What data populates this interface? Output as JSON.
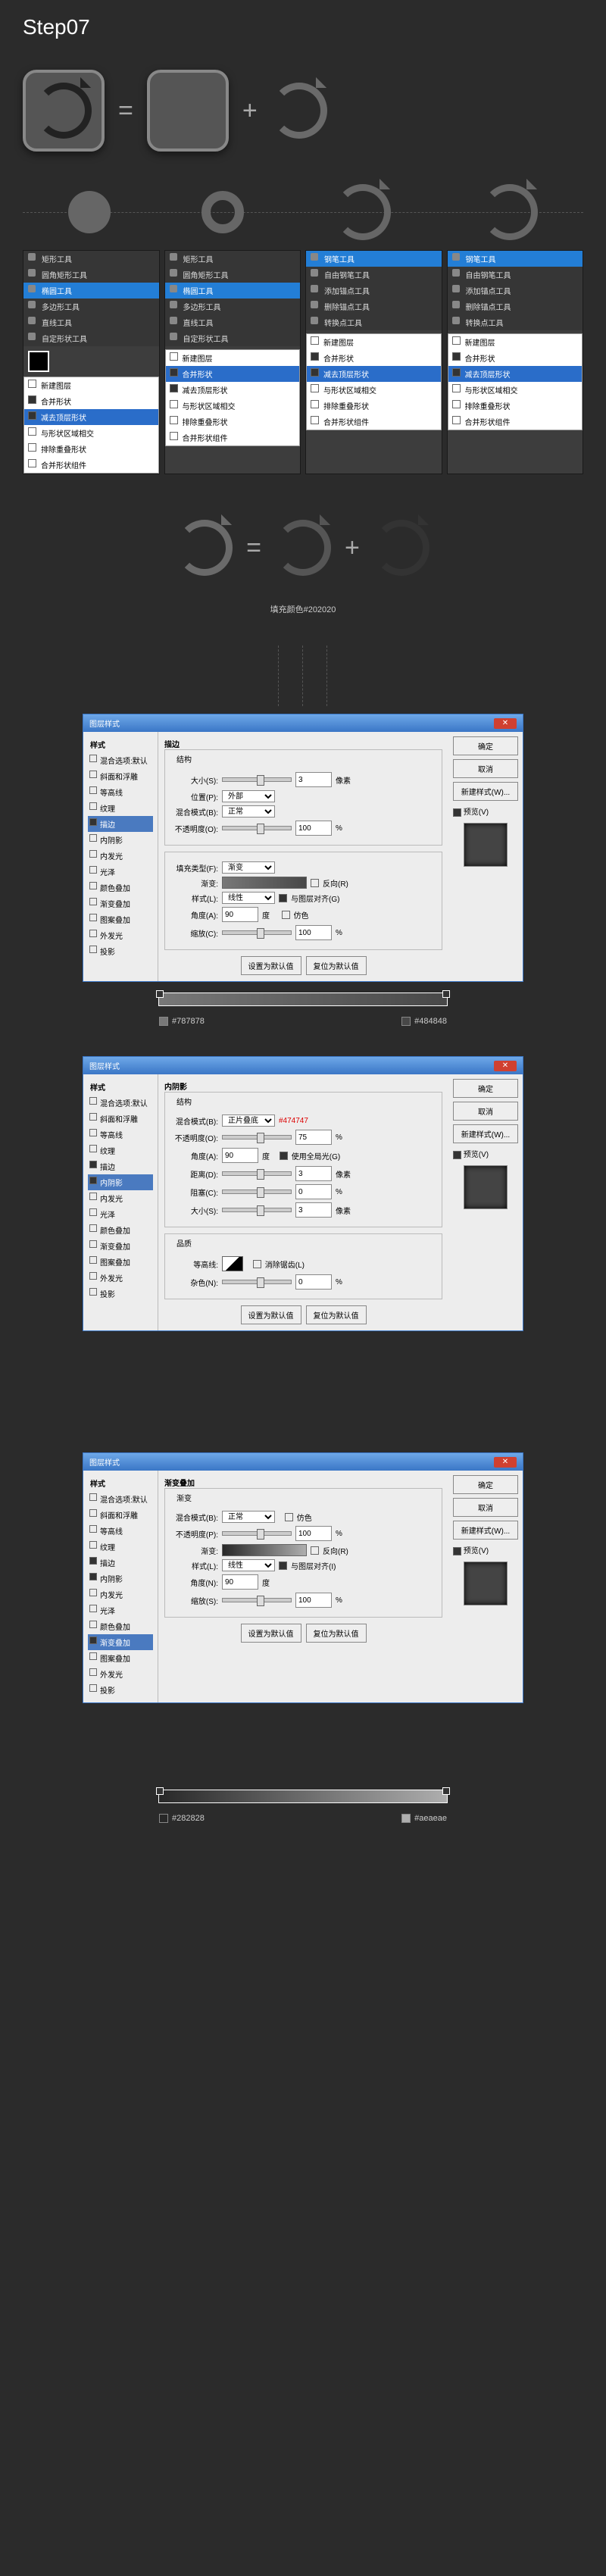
{
  "title": "Step07",
  "ops": {
    "eq": "=",
    "plus": "+"
  },
  "fill_label": "填充颜色#202020",
  "tool_groups": [
    {
      "items": [
        "矩形工具",
        "圆角矩形工具",
        "椭圆工具",
        "多边形工具",
        "直线工具",
        "自定形状工具"
      ],
      "sel": 2,
      "sub": {
        "items": [
          "新建图层",
          "合并形状",
          "减去顶层形状",
          "与形状区域相交",
          "排除重叠形状",
          "合并形状组件"
        ],
        "sel": 3
      }
    },
    {
      "items": [
        "矩形工具",
        "圆角矩形工具",
        "椭圆工具",
        "多边形工具",
        "直线工具",
        "自定形状工具"
      ],
      "sel": 2,
      "sub": {
        "items": [
          "新建图层",
          "合并形状",
          "减去顶层形状",
          "与形状区域相交",
          "排除重叠形状",
          "合并形状组件"
        ],
        "sel": 2
      }
    },
    {
      "items": [
        "钢笔工具",
        "自由钢笔工具",
        "添加锚点工具",
        "删除锚点工具",
        "转换点工具"
      ],
      "sel": 0,
      "sub": {
        "items": [
          "新建图层",
          "合并形状",
          "减去顶层形状",
          "与形状区域相交",
          "排除重叠形状",
          "合并形状组件"
        ],
        "sel": 2
      }
    },
    {
      "items": [
        "钢笔工具",
        "自由钢笔工具",
        "添加锚点工具",
        "删除锚点工具",
        "转换点工具"
      ],
      "sel": 0,
      "sub": {
        "items": [
          "新建图层",
          "合并形状",
          "减去顶层形状",
          "与形状区域相交",
          "排除重叠形状",
          "合并形状组件"
        ],
        "sel": 2
      }
    }
  ],
  "dlg_title": "图层样式",
  "styles": [
    "斜面和浮雕",
    "等高线",
    "纹理",
    "描边",
    "内阴影",
    "内发光",
    "光泽",
    "颜色叠加",
    "渐变叠加",
    "图案叠加",
    "外发光",
    "投影"
  ],
  "side_label": "混合选项:默认",
  "side_header": "样式",
  "preview_cb": "预览(V)",
  "right_btns": {
    "ok": "确定",
    "cancel": "取消",
    "new": "新建样式(W)..."
  },
  "dlg1": {
    "active": "描边",
    "checked": [
      "描边"
    ],
    "section": "描边",
    "sub": "结构",
    "fields": {
      "size_l": "大小(S):",
      "size": "3",
      "px": "像素",
      "pos_l": "位置(P):",
      "pos": "外部",
      "blend_l": "混合模式(B):",
      "blend": "正常",
      "opac_l": "不透明度(O):",
      "opac": "100",
      "pct": "%"
    },
    "fill": {
      "type_l": "填充类型(F):",
      "type": "渐变",
      "grad_l": "渐变:",
      "rev": "反向(R)",
      "style_l": "样式(L):",
      "style": "线性",
      "align": "与图层对齐(G)",
      "angle_l": "角度(A):",
      "angle": "90",
      "deg": "度",
      "dither": "仿色",
      "scale_l": "缩放(C):",
      "scale": "100"
    },
    "btm": {
      "def": "设置为默认值",
      "reset": "复位为默认值"
    }
  },
  "swatch1": {
    "a": "#787878",
    "b": "#484848"
  },
  "dlg2": {
    "active": "内阴影",
    "checked": [
      "描边",
      "内阴影"
    ],
    "section": "内阴影",
    "sub": "结构",
    "note": "#474747",
    "fields": {
      "blend_l": "混合模式(B):",
      "blend": "正片叠底",
      "opac_l": "不透明度(O):",
      "opac": "75",
      "angle_l": "角度(A):",
      "angle": "90",
      "deg": "度",
      "glob": "使用全局光(G)",
      "dist_l": "距离(D):",
      "dist": "3",
      "px": "像素",
      "spread_l": "阻塞(C):",
      "spread": "0",
      "size_l": "大小(S):",
      "size": "3"
    },
    "qhdr": "品质",
    "contour_l": "等高线:",
    "alias": "消除锯齿(L)",
    "noise_l": "杂色(N):",
    "noise": "0",
    "btm": {
      "def": "设置为默认值",
      "reset": "复位为默认值"
    }
  },
  "dlg3": {
    "active": "渐变叠加",
    "checked": [
      "描边",
      "内阴影",
      "渐变叠加"
    ],
    "section": "渐变叠加",
    "sub": "渐变",
    "fields": {
      "blend_l": "混合模式(B):",
      "blend": "正常",
      "dither": "仿色",
      "opac_l": "不透明度(P):",
      "opac": "100",
      "grad_l": "渐变:",
      "rev": "反向(R)",
      "style_l": "样式(L):",
      "style": "线性",
      "align": "与图层对齐(I)",
      "angle_l": "角度(N):",
      "angle": "90",
      "deg": "度",
      "scale_l": "缩放(S):",
      "scale": "100"
    },
    "btm": {
      "def": "设置为默认值",
      "reset": "复位为默认值"
    }
  },
  "swatch2": {
    "a": "#282828",
    "b": "#aeaeae"
  }
}
